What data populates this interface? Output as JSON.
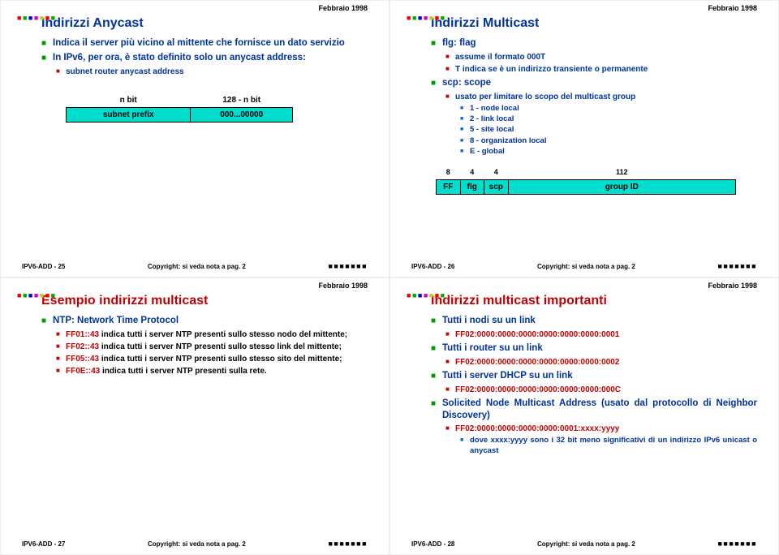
{
  "common": {
    "date": "Febbraio 1998",
    "copyright": "Copyright: si veda nota a pag. 2"
  },
  "s25": {
    "id": "IPV6-ADD - 25",
    "title": "Indirizzi Anycast",
    "b1": "Indica il server più vicino al mittente che fornisce un dato servizio",
    "b2": "In IPv6, per ora, è stato definito solo un anycast address:",
    "b2a": "subnet router anycast address",
    "tbl": {
      "h1": "n bit",
      "h2": "128 - n bit",
      "c1": "subnet prefix",
      "c2": "000...00000"
    }
  },
  "s26": {
    "id": "IPV6-ADD - 26",
    "title": "Indirizzi Multicast",
    "b1": "flg: flag",
    "b1a": "assume il formato 000T",
    "b1b": "T indica se è un indirizzo transiente o permanente",
    "b2": "scp: scope",
    "b2a": "usato per limitare lo scopo del multicast group",
    "b2b": "1 - node local",
    "b2c": "2 - link local",
    "b2d": "5 - site local",
    "b2e": "8 - organization local",
    "b2f": "E - global",
    "n1": "8",
    "n2": "4",
    "n3": "4",
    "n4": "112",
    "c1": "FF",
    "c2": "flg",
    "c3": "scp",
    "c4": "group ID"
  },
  "s27": {
    "id": "IPV6-ADD - 27",
    "title": "Esempio indirizzi multicast",
    "b1": "NTP: Network Time Protocol",
    "i1a": "FF01::43",
    "i1b": " indica tutti i server NTP presenti sullo stesso nodo del mittente;",
    "i2a": "FF02::43",
    "i2b": " indica tutti i server NTP presenti sullo stesso link del mittente;",
    "i3a": "FF05::43",
    "i3b": " indica tutti i server NTP presenti sullo stesso sito del mittente;",
    "i4a": "FF0E::43",
    "i4b": " indica tutti i server NTP presenti sulla rete."
  },
  "s28": {
    "id": "IPV6-ADD - 28",
    "title": "Indirizzi multicast importanti",
    "b1": "Tutti i nodi su un link",
    "a1": "FF02:0000:0000:0000:0000:0000:0000:0001",
    "b2": "Tutti i router su un link",
    "a2": "FF02:0000:0000:0000:0000:0000:0000:0002",
    "b3": "Tutti i server DHCP su un link",
    "a3": "FF02:0000:0000:0000:0000:0000:0000:000C",
    "b4": "Solicited Node Multicast Address (usato dal protocollo di Neighbor Discovery)",
    "a4": "FF02:0000:0000:0000:0000:0001:xxxx:yyyy",
    "a4b": "dove xxxx:yyyy sono i 32 bit meno significativi di un indirizzo IPv6 unicast o anycast"
  }
}
